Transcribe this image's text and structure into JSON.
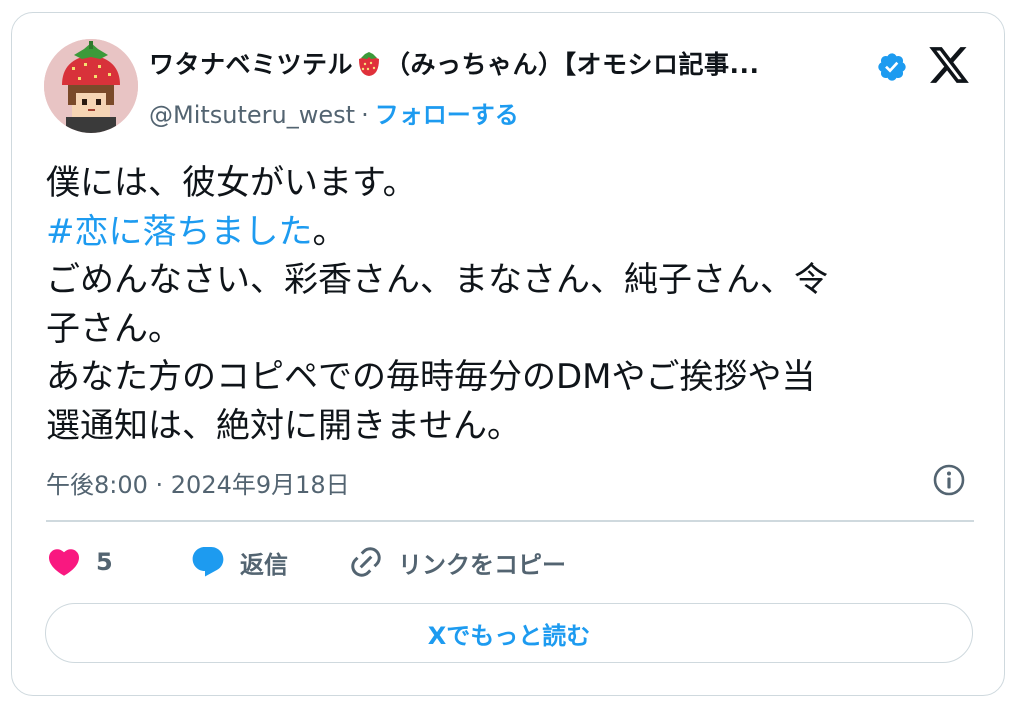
{
  "author": {
    "display_name_prefix": "ワタナベミツテル",
    "display_name_suffix": "（みっちゃん）【オモシロ記事...",
    "handle": "@Mitsuteru_west",
    "separator": "·",
    "follow_label": "フォローする",
    "verified_icon": "verified-badge-icon",
    "emoji_icon": "strawberry-icon"
  },
  "platform_icon": "x-logo-icon",
  "tweet": {
    "lines": [
      [
        {
          "text": "僕には、彼女がいます。",
          "hashtag": false
        }
      ],
      [
        {
          "text": "#恋に落ちました",
          "hashtag": true
        },
        {
          "text": "。",
          "hashtag": false
        }
      ],
      [
        {
          "text": "ごめんなさい、彩香さん、まなさん、純子さん、令",
          "hashtag": false
        }
      ],
      [
        {
          "text": "子さん。",
          "hashtag": false
        }
      ],
      [
        {
          "text": "あなた方のコピペでの毎時毎分のDMやご挨拶や当",
          "hashtag": false
        }
      ],
      [
        {
          "text": "選通知は、絶対に開きません。",
          "hashtag": false
        }
      ]
    ],
    "timestamp": "午後8:00 · 2024年9月18日"
  },
  "actions": {
    "like_count": "5",
    "reply_label": "返信",
    "copy_link_label": "リンクをコピー"
  },
  "read_more_label": "Xでもっと読む",
  "colors": {
    "accent": "#1d9bf0",
    "like": "#f91880",
    "text": "#0f1419",
    "muted": "#536471",
    "border": "#cfd9de"
  }
}
